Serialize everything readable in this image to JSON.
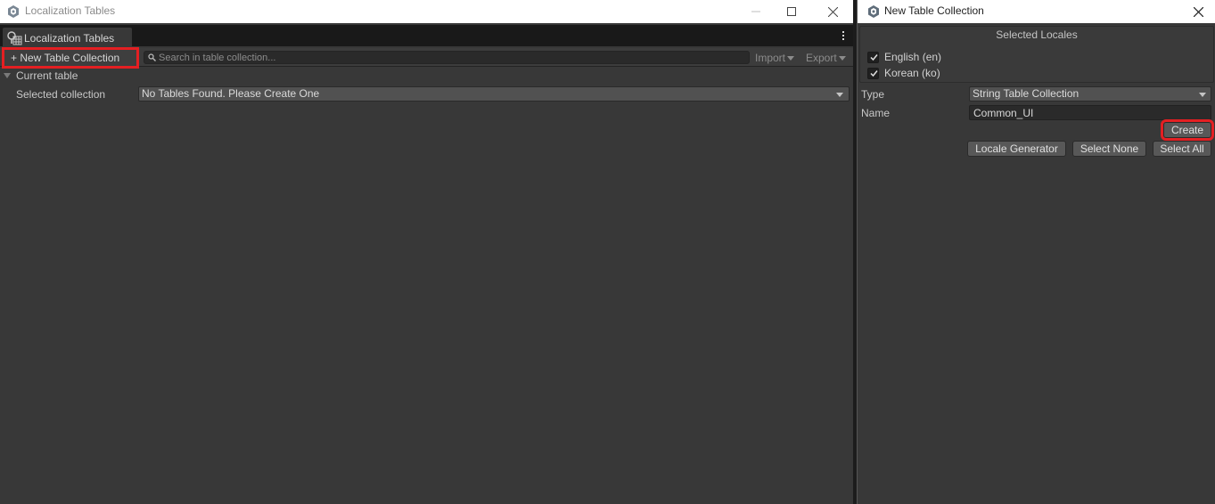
{
  "left_window": {
    "title": "Localization Tables",
    "tab_label": "Localization Tables",
    "toolbar": {
      "new_table_label": "+ New Table Collection",
      "search_placeholder": "Search in table collection...",
      "import_label": "Import",
      "export_label": "Export"
    },
    "current_table_label": "Current table",
    "selected_collection_label": "Selected collection",
    "selected_collection_value": "No Tables Found. Please Create One"
  },
  "right_window": {
    "title": "New Table Collection",
    "selected_locales_header": "Selected Locales",
    "locales": [
      {
        "label": "English (en)",
        "checked": true
      },
      {
        "label": "Korean (ko)",
        "checked": true
      }
    ],
    "type_label": "Type",
    "type_value": "String Table Collection",
    "name_label": "Name",
    "name_value": "Common_UI",
    "create_label": "Create",
    "locale_generator_label": "Locale Generator",
    "select_none_label": "Select None",
    "select_all_label": "Select All"
  },
  "icons": {
    "app": "unity-logo-icon",
    "tab": "localization-table-icon",
    "minimize": "minimize-icon",
    "maximize": "maximize-icon",
    "close": "close-icon",
    "search": "search-icon",
    "menu": "kebab-menu-icon",
    "check": "check-icon"
  },
  "colors": {
    "highlight": "#e41f22",
    "panel_bg": "#383838",
    "tabbar_bg": "#191919"
  }
}
